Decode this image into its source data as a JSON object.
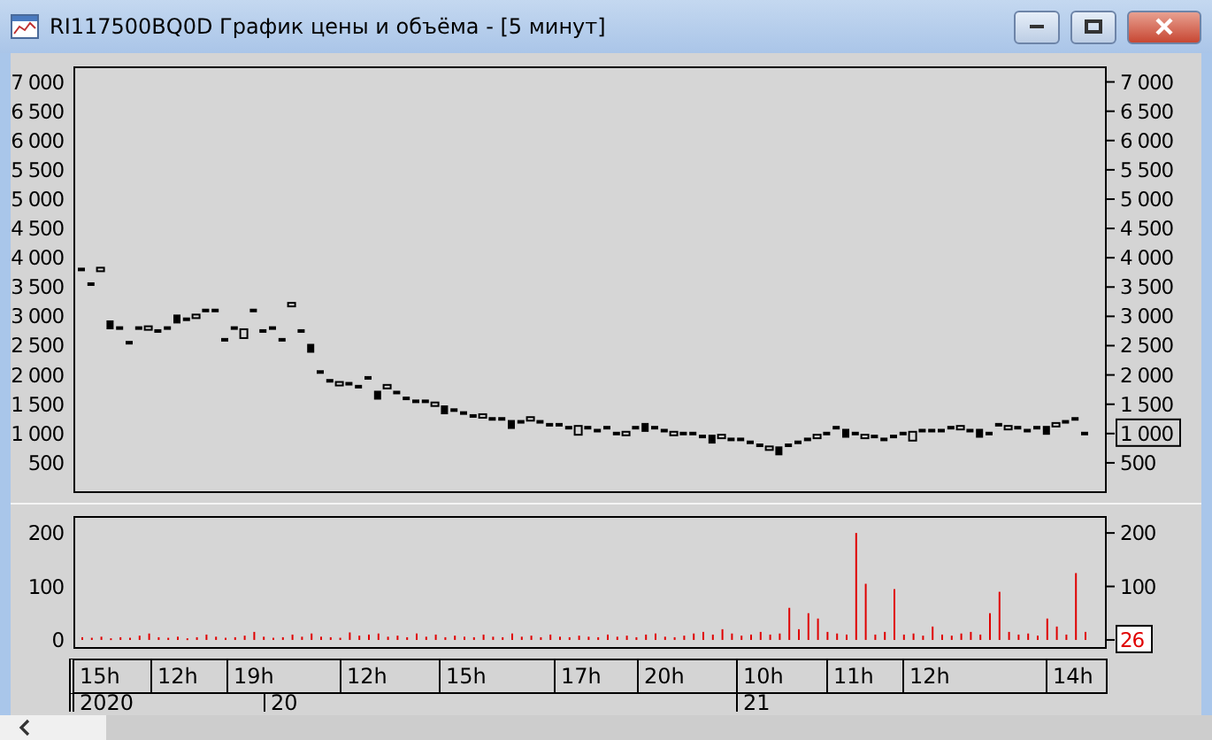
{
  "window": {
    "title": "RI117500BQ0D График цены и объёма - [5 минут]"
  },
  "price_chart": {
    "kind": "candles",
    "current_value": "1 000",
    "left_axis": [
      "7 000",
      "6 500",
      "6 000",
      "5 500",
      "5 000",
      "4 500",
      "4 000",
      "3 500",
      "3 000",
      "2 500",
      "2 000",
      "1 500",
      "1 000",
      "500"
    ],
    "right_axis": [
      "7 000",
      "6 500",
      "6 000",
      "5 500",
      "5 000",
      "4 500",
      "4 000",
      "3 500",
      "3 000",
      "2 500",
      "2 000",
      "1 500",
      "500"
    ]
  },
  "volume_chart": {
    "kind": "bars",
    "current_value": "26",
    "left_axis": [
      "200",
      "100",
      "0"
    ],
    "right_axis": [
      "200",
      "100"
    ]
  },
  "time_axis": {
    "hours": [
      "15h",
      "12h",
      "19h",
      "12h",
      "15h",
      "17h",
      "20h",
      "10h",
      "11h",
      "12h",
      "14h"
    ],
    "dates": [
      "2020",
      "20",
      "21"
    ]
  }
}
